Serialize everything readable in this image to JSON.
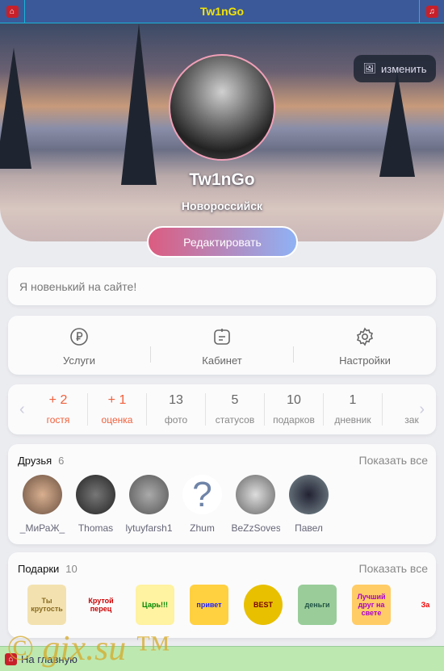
{
  "header": {
    "title": "Tw1nGo",
    "home_icon": "home-icon",
    "music_icon": "music-icon"
  },
  "profile": {
    "change_cover": "изменить",
    "name": "Tw1nGo",
    "city": "Новороссийск",
    "edit_button": "Редактировать",
    "status": "Я новенький на сайте!"
  },
  "menu": [
    {
      "label": "Услуги",
      "icon": "ruble-icon"
    },
    {
      "label": "Кабинет",
      "icon": "clipboard-icon"
    },
    {
      "label": "Настройки",
      "icon": "gear-icon"
    }
  ],
  "stats": [
    {
      "value": "+ 2",
      "label": "гостя"
    },
    {
      "value": "+ 1",
      "label": "оценка"
    },
    {
      "value": "13",
      "label": "фото"
    },
    {
      "value": "5",
      "label": "статусов"
    },
    {
      "value": "10",
      "label": "подарков"
    },
    {
      "value": "1",
      "label": "дневник"
    },
    {
      "value": "",
      "label": "зак"
    }
  ],
  "friends": {
    "title": "Друзья",
    "count": "6",
    "show_all": "Показать все",
    "items": [
      "_МиРаЖ_",
      "Thomas",
      "lytuyfarsh1",
      "Zhum",
      "BeZzSoves",
      "Павел"
    ]
  },
  "gifts": {
    "title": "Подарки",
    "count": "10",
    "show_all": "Показать все",
    "items": [
      "Ты крутость",
      "Крутой перец",
      "Царь!!!",
      "привет",
      "BEST",
      "деньги",
      "Лучший друг на свете",
      "За"
    ]
  },
  "footer": {
    "home_link": "На главную"
  },
  "watermark": "© gix.su ™",
  "colors": {
    "header_bg": "#3b5998",
    "header_title": "#f4e400",
    "accent_hot": "#f0603a",
    "footer_bg": "#bde8b0"
  }
}
